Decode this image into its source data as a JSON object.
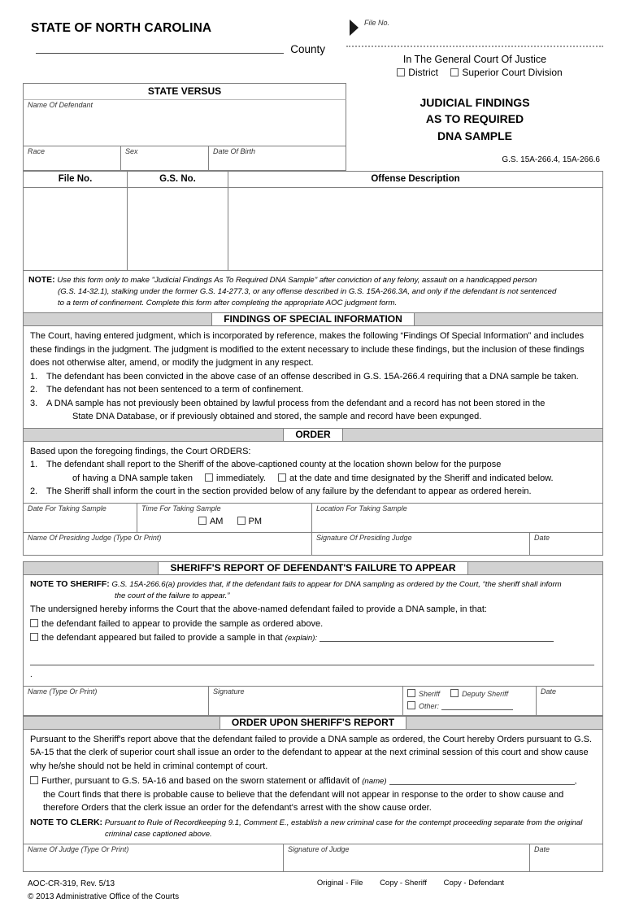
{
  "header": {
    "state_title": "STATE OF NORTH CAROLINA",
    "county_label": "County",
    "file_no_label": "File No.",
    "court_title": "In The General Court Of Justice",
    "district_label": "District",
    "superior_label": "Superior Court Division"
  },
  "caption": {
    "state_versus": "STATE VERSUS",
    "name_of_defendant": "Name Of Defendant",
    "race": "Race",
    "sex": "Sex",
    "date_of_birth": "Date Of Birth"
  },
  "title": {
    "line1": "JUDICIAL FINDINGS",
    "line2": "AS TO REQUIRED",
    "line3": "DNA SAMPLE",
    "statute_cite": "G.S. 15A-266.4, 15A-266.6"
  },
  "offense_table": {
    "headers": [
      "File No.",
      "G.S. No.",
      "Offense Description"
    ]
  },
  "note_form": {
    "label": "NOTE:",
    "line1": "Use this form only to make \"Judicial Findings As To Required DNA Sample\" after conviction of any felony, assault on a handicapped person",
    "line2": "(G.S. 14-32.1), stalking under the former G.S. 14-277.3, or any offense described in G.S. 15A-266.3A, and only if the defendant is not sentenced",
    "line3": "to a term of confinement. Complete this form after completing the appropriate AOC judgment form."
  },
  "findings": {
    "band_label": "FINDINGS OF SPECIAL INFORMATION",
    "intro": "The Court, having entered judgment, which is incorporated by reference, makes the following “Findings Of Special Information” and includes these findings in the judgment. The judgment is modified to the extent necessary to include these findings, but the inclusion of these findings does not otherwise alter, amend, or modify the judgment in any respect.",
    "items": [
      {
        "n": "1.",
        "text": "The defendant has been convicted in the above case of an offense described in G.S. 15A-266.4 requiring that a DNA sample be taken."
      },
      {
        "n": "2.",
        "text": "The defendant has not been sentenced to a term of confinement."
      },
      {
        "n": "3.",
        "text": "A DNA sample has not previously been obtained by lawful process from the defendant and a record has not been stored in the",
        "sub": "State DNA Database, or if previously obtained and stored, the sample and record have been expunged."
      }
    ]
  },
  "order": {
    "band_label": "ORDER",
    "intro": "Based upon the foregoing findings, the Court ORDERS:",
    "item1_n": "1.",
    "item1_line1": "The defendant shall report to the Sheriff of the above-captioned county at the location shown below for the purpose",
    "item1_line2_a": "of having a DNA sample taken",
    "item1_opt_immediately": "immediately.",
    "item1_opt_scheduled": "at the date and time designated by the Sheriff and indicated below.",
    "item2_n": "2.",
    "item2_text": "The Sheriff shall inform the court in the section provided below of any failure by the defendant to appear as ordered herein.",
    "field_date_for_sample": "Date For Taking Sample",
    "field_time_for_sample": "Time For Taking Sample",
    "field_location_for_sample": "Location For Taking Sample",
    "am_label": "AM",
    "pm_label": "PM",
    "field_judge_name": "Name Of Presiding Judge (Type Or Print)",
    "field_judge_signature": "Signature Of Presiding Judge",
    "field_date": "Date"
  },
  "sheriff_report": {
    "band_label": "SHERIFF'S REPORT OF DEFENDANT'S FAILURE TO APPEAR",
    "note_label": "NOTE TO SHERIFF:",
    "note_line1": "G.S. 15A-266.6(a) provides that, if the defendant fails to appear for DNA sampling as ordered by the Court, “the sheriff shall inform",
    "note_line2": "the court of the failure to appear.”",
    "intro": "The undersigned hereby informs the Court that the above-named defendant failed to provide a DNA sample, in that:",
    "opt1": "the defendant failed to appear to provide the sample as ordered above.",
    "opt2": "the defendant appeared but failed to provide a sample in that",
    "opt2_explain": "(explain):",
    "field_name": "Name (Type Or Print)",
    "field_signature": "Signature",
    "role_sheriff": "Sheriff",
    "role_deputy": "Deputy Sheriff",
    "role_other": "Other:",
    "field_date": "Date"
  },
  "order_upon_report": {
    "band_label": "ORDER UPON SHERIFF'S REPORT",
    "para": "Pursuant to the Sheriff's report above that the defendant failed to provide a DNA sample as ordered, the Court hereby Orders pursuant to G.S. 5A-15 that the clerk of superior court shall issue an order to the defendant to appear at the next criminal session of this court and show cause why he/she should not be held in criminal contempt of court.",
    "further_text": "Further, pursuant to G.S. 5A-16 and based on the sworn statement or affidavit of",
    "further_name": "(name)",
    "further_cont1": "the Court finds that there is probable cause to believe that the defendant will not appear in response to the order to show cause and",
    "further_cont2": "therefore Orders that the clerk issue an order for the defendant's arrest with the show cause order.",
    "clerk_note_label": "NOTE TO CLERK:",
    "clerk_note_text": "Pursuant to Rule of Recordkeeping 9.1, Comment E., establish a new criminal case for the contempt proceeding separate from the original criminal case captioned above.",
    "field_judge_name": "Name Of Judge (Type Or Print)",
    "field_judge_signature": "Signature of Judge",
    "field_date": "Date"
  },
  "footer": {
    "form_id": "AOC-CR-319, Rev. 5/13",
    "copyright": "© 2013 Administrative Office of the Courts",
    "dist1": "Original - File",
    "dist2": "Copy - Sheriff",
    "dist3": "Copy - Defendant"
  }
}
